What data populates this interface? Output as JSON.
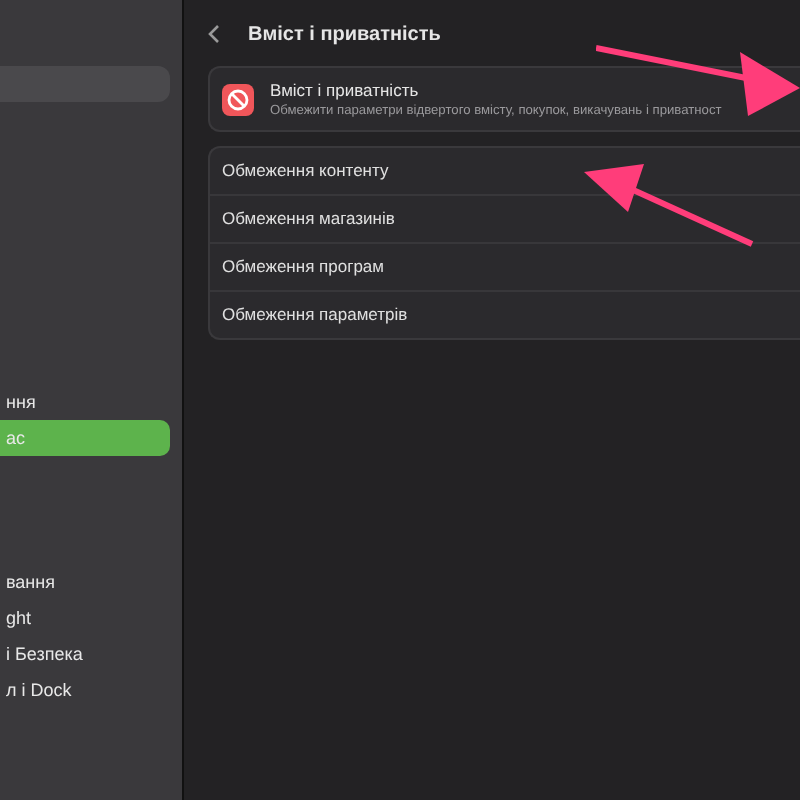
{
  "sidebar": {
    "items": [
      {
        "label": "ння",
        "selected": false
      },
      {
        "label": "ас",
        "selected": true
      },
      {
        "label": "вання",
        "selected": false
      },
      {
        "label": "ght",
        "selected": false
      },
      {
        "label": "і Безпека",
        "selected": false
      },
      {
        "label": "л і Dock",
        "selected": false
      }
    ]
  },
  "header": {
    "title": "Вміст і приватність"
  },
  "summary": {
    "title": "Вміст і приватність",
    "subtitle": "Обмежити параметри відвертого вмісту, покупок, викачувань і приватност"
  },
  "rows": [
    "Обмеження контенту",
    "Обмеження магазинів",
    "Обмеження програм",
    "Обмеження параметрів"
  ]
}
